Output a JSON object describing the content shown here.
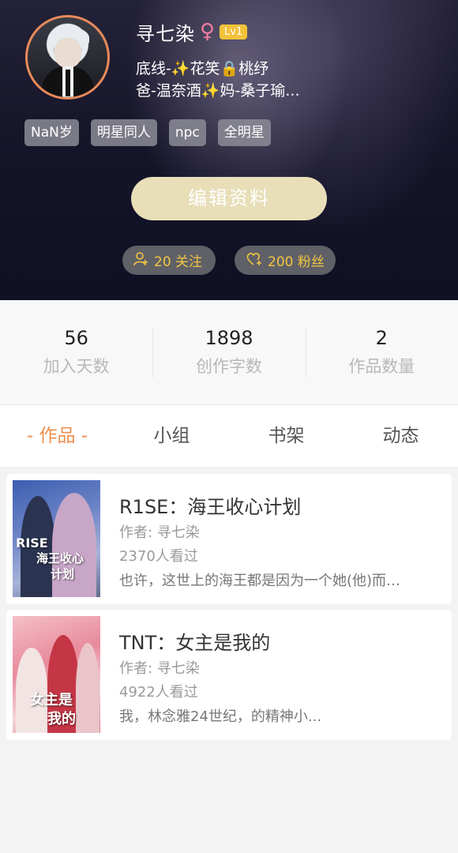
{
  "profile": {
    "name": "寻七染",
    "gender_icon": "♀",
    "level": "Lv1",
    "bio_line1": {
      "a": "底线-",
      "sparkle": "✨",
      "b": "花笑",
      "lock": "🔒",
      "c": "桃纾"
    },
    "bio_line2": {
      "a": "爸-温奈酒",
      "sparkle": "✨",
      "b": "妈-桑子瑜..."
    },
    "tags": [
      "NaN岁",
      "明星同人",
      "npc",
      "全明星"
    ],
    "edit_button": "编辑资料",
    "following_label": "20 关注",
    "fans_label": "200 粉丝",
    "following_icon": "user-plus-icon",
    "fans_icon": "heart-plus-icon"
  },
  "stats": [
    {
      "value": "56",
      "label": "加入天数"
    },
    {
      "value": "1898",
      "label": "创作字数"
    },
    {
      "value": "2",
      "label": "作品数量"
    }
  ],
  "tabs": [
    {
      "label": "- 作品 -",
      "active": true
    },
    {
      "label": "小组",
      "active": false
    },
    {
      "label": "书架",
      "active": false
    },
    {
      "label": "动态",
      "active": false
    }
  ],
  "works": [
    {
      "title": "R1SE：海王收心计划",
      "author": "作者: 寻七染",
      "views": "2370人看过",
      "description": "也许，这世上的海王都是因为一个她(他)而…",
      "cover_text_1": "RISE",
      "cover_text_2": "海王收心",
      "cover_text_3": "计划"
    },
    {
      "title": "TNT：女主是我的",
      "author": "作者: 寻七染",
      "views": "4922人看过",
      "description": "我，林念雅24世纪，的精神小...",
      "cover_text_1": "女主是",
      "cover_text_2": "我的"
    }
  ],
  "colors": {
    "accent_orange": "#ee8e4e",
    "gold": "#f3c640",
    "edit_button_bg": "#e8dfb9"
  }
}
